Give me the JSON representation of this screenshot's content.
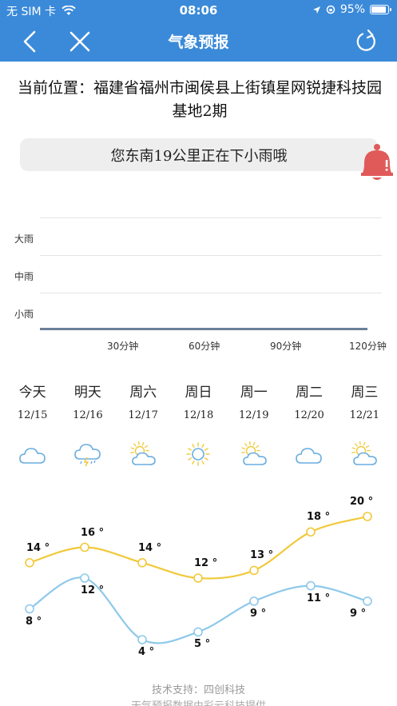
{
  "status_bar": {
    "carrier": "无 SIM 卡",
    "time": "08:06",
    "battery": "95%",
    "battery_level": 0.95
  },
  "nav": {
    "title": "气象预报",
    "back_icon": "chevron-left-icon",
    "close_icon": "close-icon",
    "refresh_icon": "refresh-icon"
  },
  "location": {
    "text": "当前位置：福建省福州市闽侯县上街镇星网锐捷科技园基地2期"
  },
  "rain_alert": {
    "text": "您东南19公里正在下小雨哦",
    "icon": "bell-icon",
    "color": "#e05a5a"
  },
  "rain_chart": {
    "y_labels": [
      "大雨",
      "中雨",
      "小雨"
    ],
    "x_labels": [
      "30分钟",
      "60分钟",
      "90分钟",
      "120分钟"
    ]
  },
  "forecast": {
    "days": [
      {
        "name": "今天",
        "date": "12/15",
        "icon": "cloudy-icon"
      },
      {
        "name": "明天",
        "date": "12/16",
        "icon": "thunder-rain-icon"
      },
      {
        "name": "周六",
        "date": "12/17",
        "icon": "partly-cloudy-icon"
      },
      {
        "name": "周日",
        "date": "12/18",
        "icon": "sunny-icon"
      },
      {
        "name": "周一",
        "date": "12/19",
        "icon": "partly-cloudy-icon"
      },
      {
        "name": "周二",
        "date": "12/20",
        "icon": "cloudy-icon"
      },
      {
        "name": "周三",
        "date": "12/21",
        "icon": "partly-cloudy-icon"
      }
    ],
    "high_temps": [
      14,
      16,
      14,
      12,
      13,
      18,
      20
    ],
    "low_temps": [
      8,
      12,
      4,
      5,
      9,
      11,
      9
    ],
    "degree_suffix": " °",
    "high_color": "#f0c93a",
    "low_color": "#8ec9ea"
  },
  "footer": {
    "support": "技术支持：四创科技",
    "source": "天气预报数据由彩云科技提供"
  }
}
